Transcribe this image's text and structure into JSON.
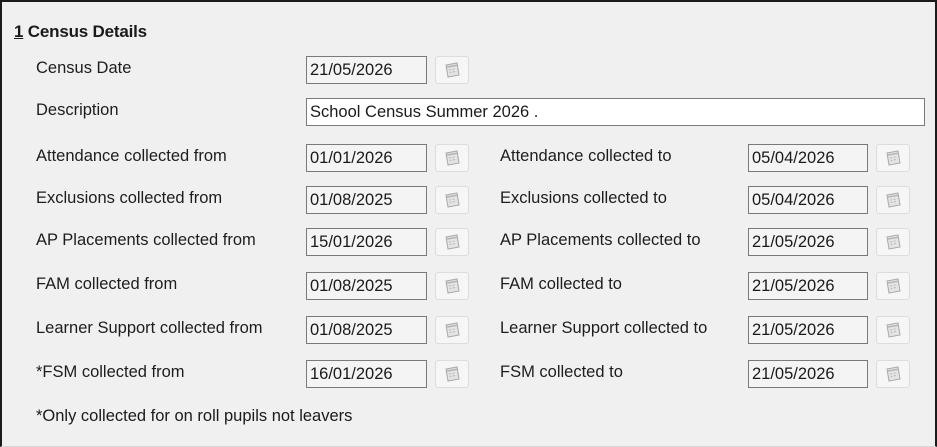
{
  "section": {
    "number": "1",
    "title": "Census Details"
  },
  "census_date": {
    "label": "Census Date",
    "value": "21/05/2026"
  },
  "description": {
    "label": "Description",
    "value": "School Census Summer 2026 ."
  },
  "rows": [
    {
      "from_label": "Attendance collected from",
      "from_value": "01/01/2026",
      "to_label": "Attendance collected to",
      "to_value": "05/04/2026"
    },
    {
      "from_label": "Exclusions collected from",
      "from_value": "01/08/2025",
      "to_label": "Exclusions collected to",
      "to_value": "05/04/2026"
    },
    {
      "from_label": "AP Placements collected from",
      "from_value": "15/01/2026",
      "to_label": "AP Placements collected to",
      "to_value": "21/05/2026"
    },
    {
      "from_label": "FAM collected from",
      "from_value": "01/08/2025",
      "to_label": "FAM collected to",
      "to_value": "21/05/2026"
    },
    {
      "from_label": "Learner Support collected from",
      "from_value": "01/08/2025",
      "to_label": "Learner Support collected to",
      "to_value": "21/05/2026"
    },
    {
      "from_label": "*FSM collected from",
      "from_value": "16/01/2026",
      "to_label": "FSM collected to",
      "to_value": "21/05/2026"
    }
  ],
  "footnote": "*Only collected for on roll pupils not leavers",
  "icons": {
    "date_picker": "calendar-icon"
  }
}
